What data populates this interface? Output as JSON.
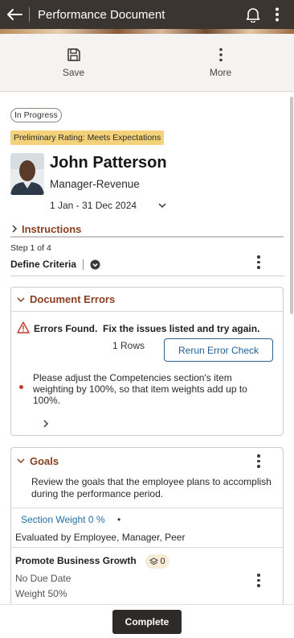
{
  "header": {
    "title": "Performance Document"
  },
  "toolbar": {
    "save_label": "Save",
    "more_label": "More"
  },
  "document": {
    "status": "In Progress",
    "preliminary_rating": "Preliminary Rating: Meets Expectations",
    "employee_name": "John Patterson",
    "job_title": "Manager-Revenue",
    "period": "1 Jan - 31 Dec 2024"
  },
  "instructions": {
    "label": "Instructions"
  },
  "step": {
    "counter": "Step 1 of 4",
    "name": "Define Criteria"
  },
  "errors": {
    "title": "Document Errors",
    "heading": "Errors Found.  Fix the issues listed and try again.",
    "rows": "1 Rows",
    "rerun_label": "Rerun Error Check",
    "message": "Please adjust the Competencies section's item weighting by 100%, so that item weights add up to 100%."
  },
  "goals": {
    "title": "Goals",
    "description": "Review the goals that the employee plans to accomplish during the performance period.",
    "section_weight": "Section Weight 0 %",
    "dot": "•",
    "evaluated_by": "Evaluated by Employee, Manager, Peer",
    "item": {
      "name": "Promote Business Growth",
      "badge_count": "0",
      "due": "No Due Date",
      "weight": "Weight 50%"
    }
  },
  "footer": {
    "complete_label": "Complete"
  },
  "colors": {
    "header_bg": "#3b3532",
    "accent": "#8a3f1f",
    "link": "#1f6fa8",
    "rating_bg": "#f3d27a",
    "error": "#c0392b"
  }
}
